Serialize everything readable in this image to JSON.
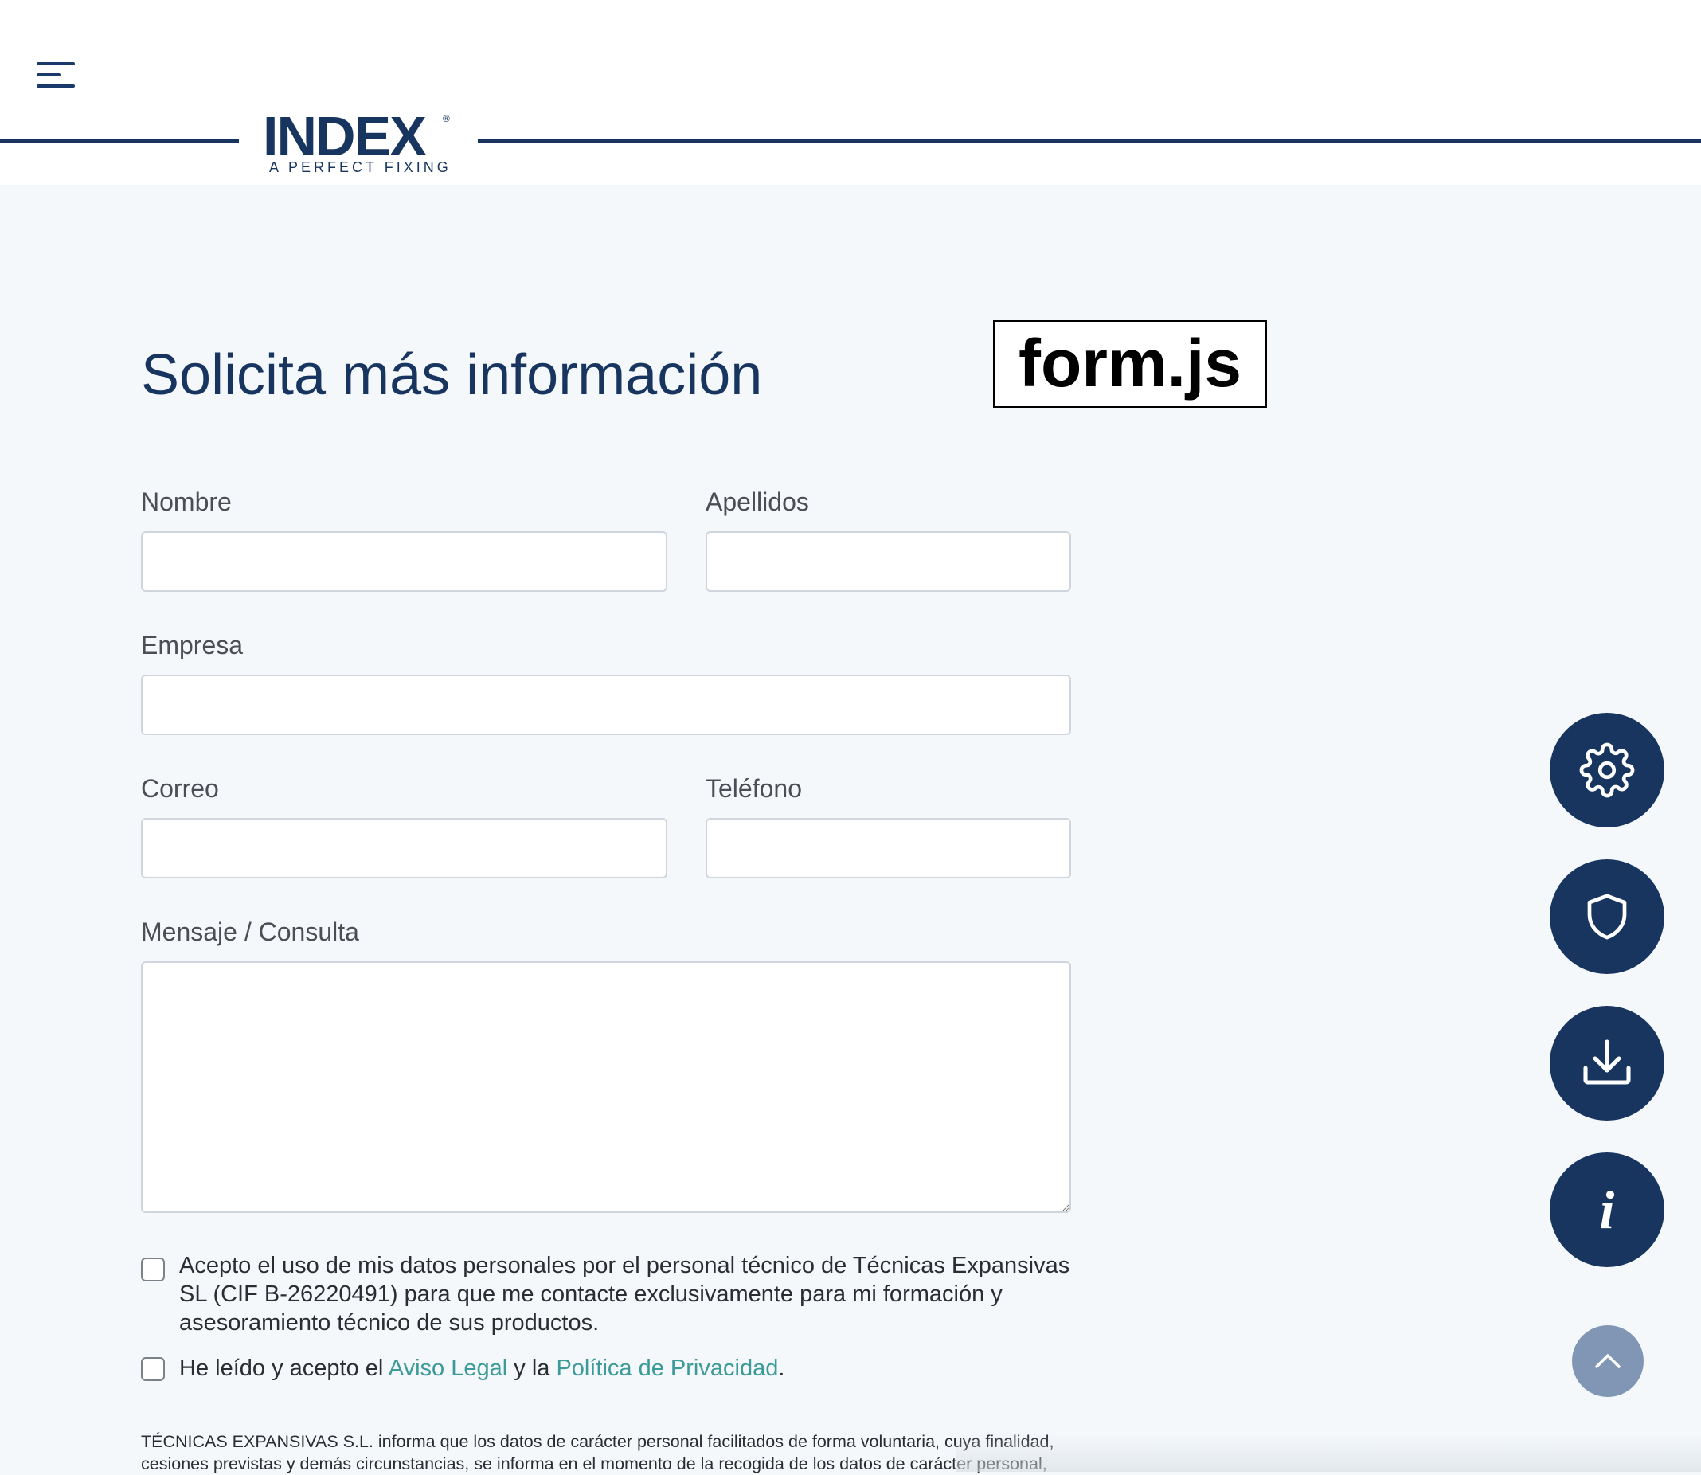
{
  "header": {
    "logo_word": "INDEX",
    "logo_reg": "®",
    "logo_tagline": "A PERFECT FIXING"
  },
  "title": "Solicita más información",
  "code_label": "form.js",
  "form": {
    "nombre_label": "Nombre",
    "nombre_value": "",
    "apellidos_label": "Apellidos",
    "apellidos_value": "",
    "empresa_label": "Empresa",
    "empresa_value": "",
    "correo_label": "Correo",
    "correo_value": "",
    "telefono_label": "Teléfono",
    "telefono_value": "",
    "mensaje_label": "Mensaje / Consulta",
    "mensaje_value": ""
  },
  "consent": {
    "data_use_text": "Acepto el uso de mis datos personales por el personal técnico de Técnicas Expansivas SL (CIF B-26220491) para que me contacte exclusivamente para mi formación y asesoramiento técnico de sus productos.",
    "data_use_checked": false,
    "legal_prefix": "He leído y acepto el ",
    "aviso_legal": "Aviso Legal",
    "legal_middle": " y la ",
    "privacidad": "Política de Privacidad",
    "legal_suffix": ".",
    "legal_checked": false
  },
  "legal_notice": "TÉCNICAS EXPANSIVAS S.L. informa que los datos de carácter personal facilitados de forma voluntaria, cuya finalidad, cesiones previstas y demás circunstancias, se informa en el momento de la recogida de los datos de carácter personal,",
  "floating_buttons": [
    "gear-icon",
    "shield-icon",
    "download-icon",
    "info-icon"
  ],
  "colors": {
    "brand": "#17355f",
    "link": "#3c9a98",
    "background": "#f4f8fb",
    "scroll_top": "#8096b4"
  }
}
